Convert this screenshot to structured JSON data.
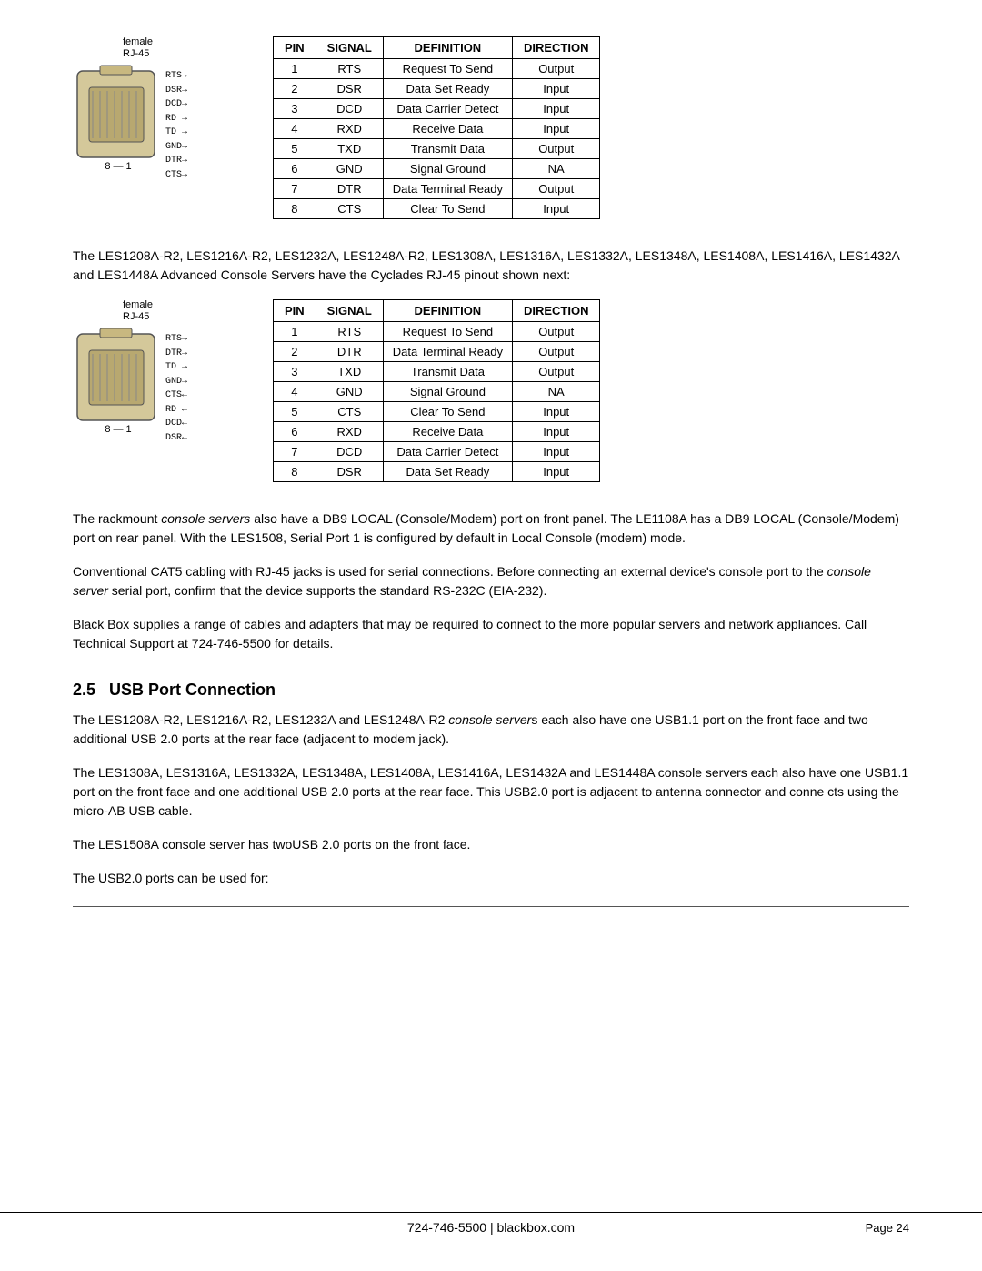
{
  "tables": {
    "table1": {
      "headers": [
        "PIN",
        "SIGNAL",
        "DEFINITION",
        "DIRECTION"
      ],
      "rows": [
        [
          "1",
          "RTS",
          "Request To Send",
          "Output"
        ],
        [
          "2",
          "DSR",
          "Data Set Ready",
          "Input"
        ],
        [
          "3",
          "DCD",
          "Data Carrier Detect",
          "Input"
        ],
        [
          "4",
          "RXD",
          "Receive Data",
          "Input"
        ],
        [
          "5",
          "TXD",
          "Transmit Data",
          "Output"
        ],
        [
          "6",
          "GND",
          "Signal Ground",
          "NA"
        ],
        [
          "7",
          "DTR",
          "Data Terminal Ready",
          "Output"
        ],
        [
          "8",
          "CTS",
          "Clear To Send",
          "Input"
        ]
      ]
    },
    "table2": {
      "headers": [
        "PIN",
        "SIGNAL",
        "DEFINITION",
        "DIRECTION"
      ],
      "rows": [
        [
          "1",
          "RTS",
          "Request To Send",
          "Output"
        ],
        [
          "2",
          "DTR",
          "Data Terminal Ready",
          "Output"
        ],
        [
          "3",
          "TXD",
          "Transmit Data",
          "Output"
        ],
        [
          "4",
          "GND",
          "Signal Ground",
          "NA"
        ],
        [
          "5",
          "CTS",
          "Clear To Send",
          "Input"
        ],
        [
          "6",
          "RXD",
          "Receive Data",
          "Input"
        ],
        [
          "7",
          "DCD",
          "Data Carrier Detect",
          "Input"
        ],
        [
          "8",
          "DSR",
          "Data Set Ready",
          "Input"
        ]
      ]
    }
  },
  "connector1": {
    "label_top": "female",
    "label_sub": "RJ-45",
    "pins": [
      "RTS",
      "DSR",
      "DCD",
      "RD",
      "TD",
      "GND",
      "DTR",
      "CTS"
    ],
    "numbering": "8 — 1",
    "arrows": [
      "right",
      "right",
      "right",
      "right",
      "right",
      "right",
      "right",
      "right"
    ]
  },
  "connector2": {
    "label_top": "female",
    "label_sub": "RJ-45",
    "pins": [
      "RTS",
      "DTR",
      "TD",
      "GND",
      "CTS",
      "RD",
      "DCD",
      "DSR"
    ],
    "numbering": "8 — 1",
    "arrows": [
      "right",
      "right",
      "right",
      "right",
      "right",
      "right",
      "right",
      "right"
    ]
  },
  "text_blocks": {
    "intro2": "The LES1208A-R2, LES1216A-R2, LES1232A, LES1248A-R2, LES1308A, LES1316A, LES1332A, LES1348A, LES1408A, LES1416A, LES1432A and LES1448A Advanced Console Servers have the Cyclades RJ-45 pinout shown next:",
    "para1": "The rackmount console servers also have a DB9 LOCAL (Console/Modem) port on front panel.  The LE1108A has a DB9 LOCAL (Console/Modem) port on rear panel. With the LES1508, Serial Port 1 is configured by default in Local Console (modem) mode.",
    "para2": "Conventional CAT5 cabling with RJ-45 jacks is used for serial connections. Before connecting an external device's console port to the console server serial port, confirm that the device supports the standard RS-232C (EIA-232).",
    "para3": "Black Box supplies a range of cables and adapters that may be required to connect to the more popular servers and network appliances. Call Technical Support at 724-746-5500 for details.",
    "section_num": "2.5",
    "section_title": "USB Port Connection",
    "usb_para1": "The LES1208A-R2, LES1216A-R2, LES1232A and LES1248A-R2 console servers each also have one USB1.1 port on the front face and two additional USB 2.0 ports at the rear face (adjacent to modem jack).",
    "usb_para2": "The LES1308A, LES1316A, LES1332A, LES1348A, LES1408A, LES1416A, LES1432A and LES1448A console servers each also have one USB1.1 port on the front face and one additional USB 2.0 ports at the rear face. This USB2.0 port is adjacent to antenna connector and connects using the micro-AB USB cable.",
    "usb_para3": "The LES1508A console server has twoUSB 2.0 ports on the front face.",
    "usb_para4": "The USB2.0 ports can be used for:"
  },
  "footer": {
    "contact": "724-746-5500 | blackbox.com",
    "page": "Page 24"
  }
}
